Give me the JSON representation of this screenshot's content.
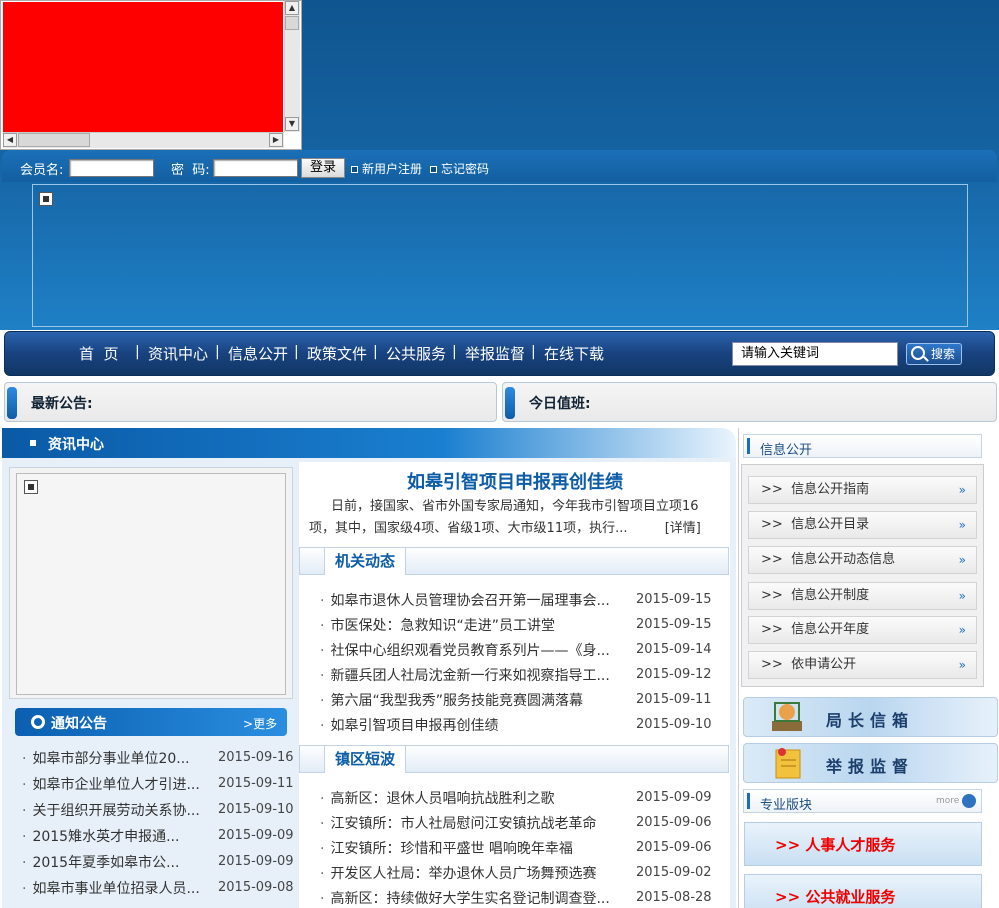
{
  "login": {
    "member_label": "会员名:",
    "password_label": "密  码:",
    "login_button": "登录",
    "register_link": "新用户注册",
    "forgot_link": "忘记密码"
  },
  "nav": {
    "items": [
      "首  页",
      "资讯中心",
      "信息公开",
      "政策文件",
      "公共服务",
      "举报监督",
      "在线下载"
    ],
    "search_placeholder": "请输入关键词",
    "search_button": "搜索"
  },
  "notice_bar": {
    "latest_label": "最新公告:",
    "duty_label": "今日值班:"
  },
  "news_center": {
    "title": "资讯中心",
    "headline": "如皋引智项目申报再创佳绩",
    "summary": "日前，接国家、省市外国专家局通知，今年我市引智项目立项16项，其中，国家级4项、省级1项、大市级11项，执行...",
    "detail_link": "[详情]"
  },
  "agency_news": {
    "title": "机关动态",
    "items": [
      {
        "title": "如皋市退休人员管理协会召开第一届理事会...",
        "date": "2015-09-15"
      },
      {
        "title": "市医保处：急救知识“走进”员工讲堂",
        "date": "2015-09-15"
      },
      {
        "title": "社保中心组织观看党员教育系列片——《身...",
        "date": "2015-09-14"
      },
      {
        "title": "新疆兵团人社局沈金新一行来如视察指导工...",
        "date": "2015-09-12"
      },
      {
        "title": "第六届“我型我秀”服务技能竞赛圆满落幕",
        "date": "2015-09-11"
      },
      {
        "title": "如皋引智项目申报再创佳绩",
        "date": "2015-09-10"
      }
    ]
  },
  "town_news": {
    "title": "镇区短波",
    "items": [
      {
        "title": "高新区：退休人员唱响抗战胜利之歌",
        "date": "2015-09-09"
      },
      {
        "title": "江安镇所：市人社局慰问江安镇抗战老革命",
        "date": "2015-09-06"
      },
      {
        "title": "江安镇所：珍惜和平盛世 唱响晚年幸福",
        "date": "2015-09-06"
      },
      {
        "title": "开发区人社局：举办退休人员广场舞预选赛",
        "date": "2015-09-02"
      },
      {
        "title": "高新区：持续做好大学生实名登记制调查登...",
        "date": "2015-08-28"
      }
    ]
  },
  "announcements": {
    "title": "通知公告",
    "more": "更多",
    "items": [
      {
        "title": "如皋市部分事业单位20...",
        "date": "2015-09-16"
      },
      {
        "title": "如皋市企业单位人才引进...",
        "date": "2015-09-11"
      },
      {
        "title": "关于组织开展劳动关系协...",
        "date": "2015-09-10"
      },
      {
        "title": "2015雉水英才申报通...",
        "date": "2015-09-09"
      },
      {
        "title": "2015年夏季如皋市公...",
        "date": "2015-09-09"
      },
      {
        "title": "如皋市事业单位招录人员...",
        "date": "2015-09-08"
      }
    ]
  },
  "info_public": {
    "title": "信息公开",
    "items": [
      "信息公开指南",
      "信息公开目录",
      "信息公开动态信息",
      "信息公开制度",
      "信息公开年度",
      "依申请公开"
    ]
  },
  "big_buttons": {
    "director_mailbox": "局长信箱",
    "report": "举报监督"
  },
  "special": {
    "title": "专业版块",
    "more": "more",
    "services": [
      ">> 人事人才服务",
      ">> 公共就业服务"
    ]
  }
}
